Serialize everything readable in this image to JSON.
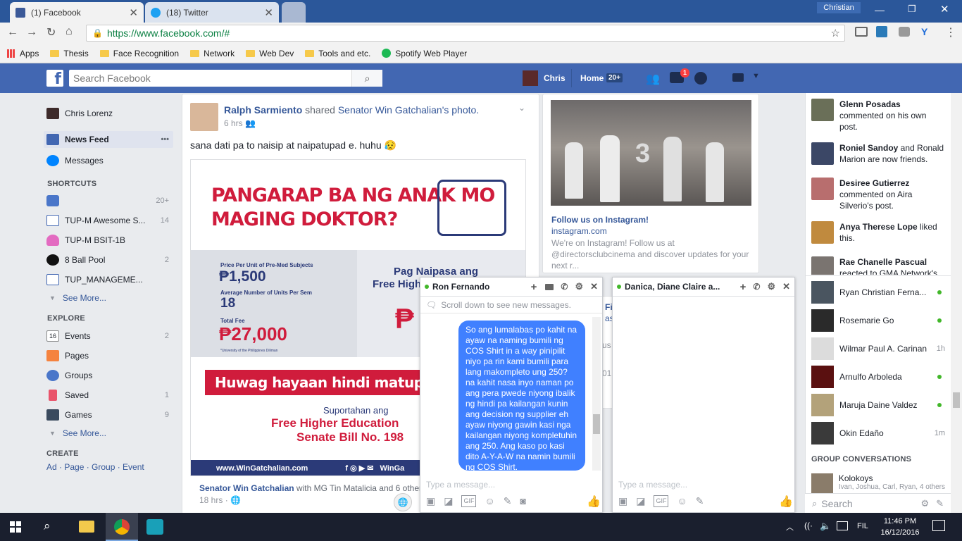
{
  "browser": {
    "tabs": [
      {
        "label": "(1) Facebook",
        "icon": "facebook-favicon"
      },
      {
        "label": "(18) Twitter",
        "icon": "twitter-favicon"
      }
    ],
    "user_badge": "Christian",
    "url": "https://www.facebook.com/#",
    "bookmarks": [
      {
        "label": "Apps",
        "icon": "apps-grid-icon"
      },
      {
        "label": "Thesis",
        "icon": "folder-icon"
      },
      {
        "label": "Face Recognition",
        "icon": "folder-icon"
      },
      {
        "label": "Network",
        "icon": "folder-icon"
      },
      {
        "label": "Web Dev",
        "icon": "folder-icon"
      },
      {
        "label": "Tools and etc.",
        "icon": "folder-icon"
      },
      {
        "label": "Spotify Web Player",
        "icon": "spotify-icon"
      }
    ]
  },
  "fb_header": {
    "search_placeholder": "Search Facebook",
    "user_name": "Chris",
    "home_label": "Home",
    "home_count": "20+",
    "messages_badge": "1"
  },
  "left_nav": {
    "profile_name": "Chris Lorenz",
    "news_feed": "News Feed",
    "messages": "Messages",
    "shortcuts_title": "SHORTCUTS",
    "shortcuts": [
      {
        "label": "",
        "count": "20+"
      },
      {
        "label": "TUP-M Awesome S...",
        "count": "14"
      },
      {
        "label": "TUP-M BSIT-1B",
        "count": ""
      },
      {
        "label": "8 Ball Pool",
        "count": "2"
      },
      {
        "label": "TUP_MANAGEME...",
        "count": ""
      }
    ],
    "see_more_1": "See More...",
    "explore_title": "EXPLORE",
    "explore": [
      {
        "label": "Events",
        "count": "2"
      },
      {
        "label": "Pages",
        "count": ""
      },
      {
        "label": "Groups",
        "count": ""
      },
      {
        "label": "Saved",
        "count": "1"
      },
      {
        "label": "Games",
        "count": "9"
      }
    ],
    "see_more_2": "See More...",
    "create_title": "CREATE",
    "create_links": "Ad · Page · Group · Event"
  },
  "post": {
    "author": "Ralph Sarmiento",
    "action": "shared",
    "source": "Senator Win Gatchalian",
    "source_suffix": "'s photo.",
    "time": "6 hrs",
    "text": "sana dati pa to naisip at naipatupad e. huhu 😥",
    "image": {
      "headline_1": "PANGARAP BA NG ANAK MO",
      "headline_2": "MAGING DOKTOR?",
      "price_label": "Price Per Unit of Pre-Med Subjects",
      "price": "₱1,500",
      "units_label": "Average Number of Units Per Sem",
      "units": "18",
      "fee_label": "Total Fee",
      "fee": "₱27,000",
      "source_note": "*University of the Philippines Diliman",
      "right_1": "Pag Naipasa ang",
      "right_2": "Free High",
      "right_price": "₱",
      "banner": "Huwag hayaan hindi matupad ang kani",
      "support": "Suportahan ang",
      "bill_1": "Free Higher Education",
      "bill_2": "Senate Bill No. 198",
      "site": "www.WinGatchalian.com",
      "site_right": "WinGa"
    },
    "footer_author": "Senator Win Gatchalian",
    "footer_with": " with MG Tin Matalicia and 6 other",
    "footer_time": "18 hrs"
  },
  "ad": {
    "title": "Follow us on Instagram!",
    "domain": "instagram.com",
    "desc": "We're on Instagram! Follow us at @directorsclubcinema and discover updates for your next r...",
    "hidden_1": "Fi",
    "hidden_2": "as",
    "hidden_3": "us",
    "hidden_4": "01"
  },
  "chat1": {
    "name": "Ron Fernando",
    "scroll_hint": "Scroll down to see new messages.",
    "message": "So ang lumalabas po kahit na ayaw na naming bumili ng COS Shirt in a way pinipilit niyo pa rin kami bumili para lang makompleto ung 250? na kahit nasa inyo naman po ang pera pwede niyong ibalik ng hindi pa kailangan kunin ang decision ng supplier eh ayaw niyong gawin kasi nga kailangan niyong kompletuhin ang 250. Ang kaso po kasi dito A-Y-A-W na namin bumili ng COS Shirt.",
    "placeholder": "Type a message..."
  },
  "chat2": {
    "name": "Danica, Diane Claire a...",
    "placeholder": "Type a message..."
  },
  "ticker": [
    {
      "name": "Glenn Posadas",
      "rest": " commented on his own post."
    },
    {
      "name": "Roniel Sandoy",
      "rest": " and Ronald Marion are now friends."
    },
    {
      "name": "Desiree Gutierrez",
      "rest": " commented on Aira Silverio's post."
    },
    {
      "name": "Anya Therese Lope",
      "rest": " liked this."
    },
    {
      "name": "Rae Chanelle Pascual",
      "rest": " reacted to GMA Network's"
    }
  ],
  "contacts": [
    {
      "name": "Ryan Christian Ferna...",
      "status": "online"
    },
    {
      "name": "Rosemarie Go",
      "status": "online"
    },
    {
      "name": "Wilmar Paul A. Carinan",
      "status": "1h"
    },
    {
      "name": "Arnulfo Arboleda",
      "status": "online"
    },
    {
      "name": "Maruja Daine Valdez",
      "status": "online"
    },
    {
      "name": "Okin Edaño",
      "status": "1m"
    }
  ],
  "group_conversations_title": "GROUP CONVERSATIONS",
  "group": {
    "name": "Kolokoys",
    "members": "Ivan, Joshua, Carl, Ryan, 4 others"
  },
  "chat_search_placeholder": "Search",
  "taskbar": {
    "time": "11:46 PM",
    "date": "16/12/2016",
    "lang": "FIL"
  },
  "colors": {
    "fb_blue": "#4267b2",
    "messenger_blue": "#4080ff",
    "online_green": "#42b72a",
    "headline_red": "#d01c3c"
  }
}
